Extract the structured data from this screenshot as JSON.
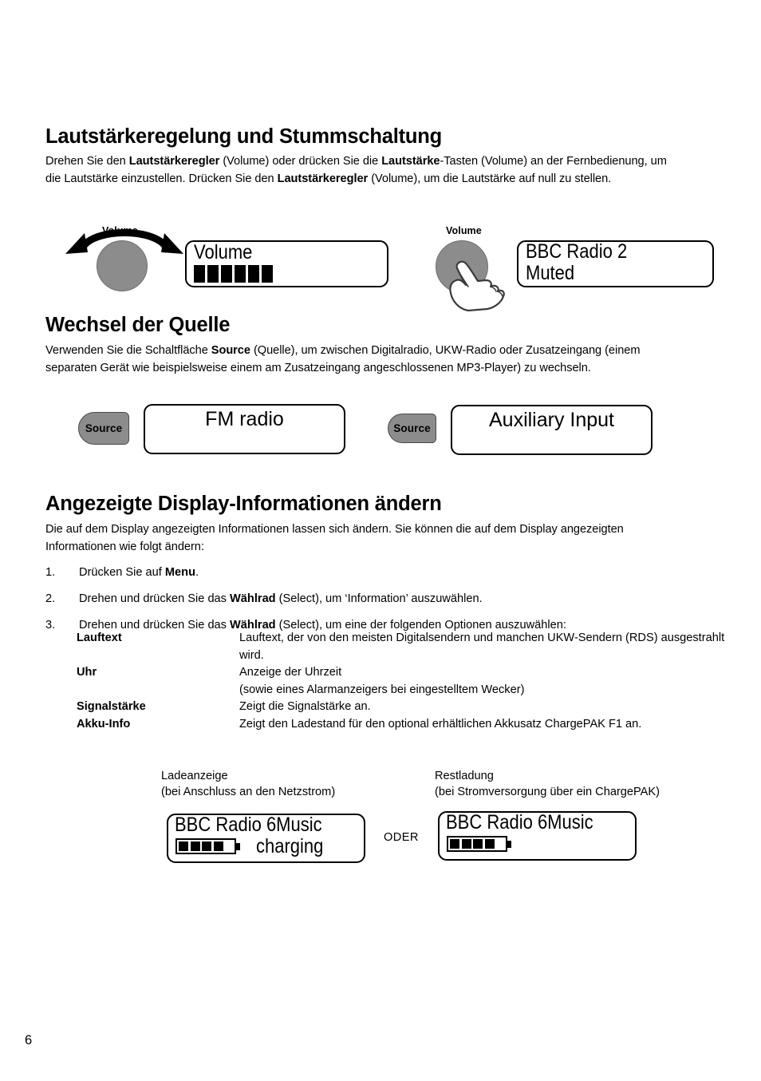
{
  "page": {
    "number": "6",
    "language": "de"
  },
  "sections": [
    {
      "id": "volume",
      "title": "Lautstärkeregelung und Stummschaltung",
      "paragraph_runs": [
        {
          "text": "Drehen Sie den ",
          "bold": false
        },
        {
          "text": "Lautstärkeregler",
          "bold": true
        },
        {
          "text": " (Volume) oder drücken Sie die ",
          "bold": false
        },
        {
          "text": "Lautstärke",
          "bold": true
        },
        {
          "text": "-Tasten (Volume) an der Fernbedienung, um die Lautstärke einzustellen. Drücken Sie den ",
          "bold": false
        },
        {
          "text": "Lautstärkeregler",
          "bold": true
        },
        {
          "text": " (Volume), um die Lautstärke auf null zu stellen.",
          "bold": false
        }
      ]
    },
    {
      "id": "source",
      "title": "Wechsel der Quelle",
      "paragraph_runs": [
        {
          "text": "Verwenden Sie die Schaltfläche ",
          "bold": false
        },
        {
          "text": "Source",
          "bold": true
        },
        {
          "text": " (Quelle), um zwischen Digitalradio, UKW-Radio oder Zusatzeingang (einem separaten Gerät wie beispielsweise einem am Zusatzeingang angeschlossenen MP3-Player) zu wechseln.",
          "bold": false
        }
      ]
    },
    {
      "id": "display-info",
      "title": "Angezeigte Display-Informationen ändern",
      "paragraph_runs": [
        {
          "text": "Die auf dem Display angezeigten Informationen lassen sich ändern. Sie können die auf dem Display angezeigten Informationen wie folgt ändern:",
          "bold": false
        }
      ]
    }
  ],
  "knobs": {
    "rotate": {
      "label": "Volume"
    },
    "press": {
      "label": "Volume"
    }
  },
  "displays": {
    "volume": {
      "line1": "Volume",
      "bar_count": 6
    },
    "muted": {
      "line1": "BBC Radio 2",
      "line2": "Muted"
    },
    "fm_radio": {
      "line1": "FM radio"
    },
    "auxiliary": {
      "line1": "Auxiliary Input"
    },
    "charging": {
      "line1": "BBC Radio 6Music",
      "line2": "charging",
      "battery_segments": 4
    },
    "remaining": {
      "line1": "BBC Radio 6Music",
      "battery_segments": 4
    }
  },
  "buttons": {
    "source_left": "Source",
    "source_right": "Source"
  },
  "steps": [
    {
      "number": "1.",
      "runs": [
        {
          "text": "Drücken Sie auf ",
          "bold": false
        },
        {
          "text": "Menu",
          "bold": true
        },
        {
          "text": ".",
          "bold": false
        }
      ]
    },
    {
      "number": "2.",
      "runs": [
        {
          "text": "Drehen und drücken Sie das ",
          "bold": false
        },
        {
          "text": "Wählrad",
          "bold": true
        },
        {
          "text": " (Select), um ‘Information’ auszuwählen.",
          "bold": false
        }
      ]
    },
    {
      "number": "3.",
      "runs": [
        {
          "text": "Drehen und drücken Sie das ",
          "bold": false
        },
        {
          "text": "Wählrad",
          "bold": true
        },
        {
          "text": " (Select), um eine der folgenden Optionen auszuwählen:",
          "bold": false
        }
      ]
    }
  ],
  "options": [
    {
      "term": "Lauftext",
      "description": "Lauftext, der von den meisten Digitalsendern und manchen UKW-Sendern (RDS) ausgestrahlt wird."
    },
    {
      "term": "Uhr",
      "description": "Anzeige der Uhrzeit\n(sowie eines Alarmanzeigers bei eingestelltem Wecker)"
    },
    {
      "term": "Signalstärke",
      "description": "Zeigt die Signalstärke an."
    },
    {
      "term": "Akku-Info",
      "description": "Zeigt den Ladestand für den optional erhältlichen Akkusatz ChargePAK F1 an."
    }
  ],
  "captions": {
    "charging": "Ladeanzeige\n(bei Anschluss an den Netzstrom)",
    "remaining": "Restladung\n(bei Stromversorgung über ein ChargePAK)",
    "or": "ODER"
  },
  "colors": {
    "knob_gray": "#8c8c8c",
    "button_gray": "#8c8c8c",
    "ink": "#000000",
    "page_bg": "#ffffff"
  }
}
